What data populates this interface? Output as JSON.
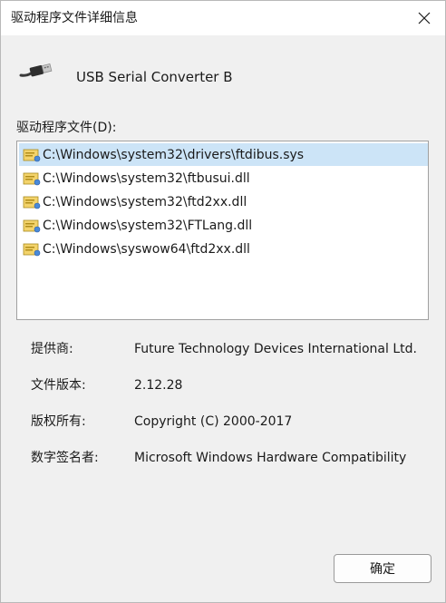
{
  "window": {
    "title": "驱动程序文件详细信息",
    "close_icon": "close-icon"
  },
  "device": {
    "icon": "usb-plug-icon",
    "name": "USB Serial Converter B"
  },
  "files": {
    "label": "驱动程序文件(D):",
    "items": [
      {
        "path": "C:\\Windows\\system32\\drivers\\ftdibus.sys",
        "selected": true
      },
      {
        "path": "C:\\Windows\\system32\\ftbusui.dll",
        "selected": false
      },
      {
        "path": "C:\\Windows\\system32\\ftd2xx.dll",
        "selected": false
      },
      {
        "path": "C:\\Windows\\system32\\FTLang.dll",
        "selected": false
      },
      {
        "path": "C:\\Windows\\syswow64\\ftd2xx.dll",
        "selected": false
      }
    ],
    "item_icon": "system-file-icon",
    "selection_color": "#cce4f7"
  },
  "info": {
    "provider_label": "提供商:",
    "provider_value": "Future Technology Devices International Ltd.",
    "version_label": "文件版本:",
    "version_value": "2.12.28",
    "copyright_label": "版权所有:",
    "copyright_value": "Copyright (C) 2000-2017",
    "signer_label": "数字签名者:",
    "signer_value": "Microsoft Windows Hardware Compatibility"
  },
  "buttons": {
    "ok_label": "确定"
  }
}
